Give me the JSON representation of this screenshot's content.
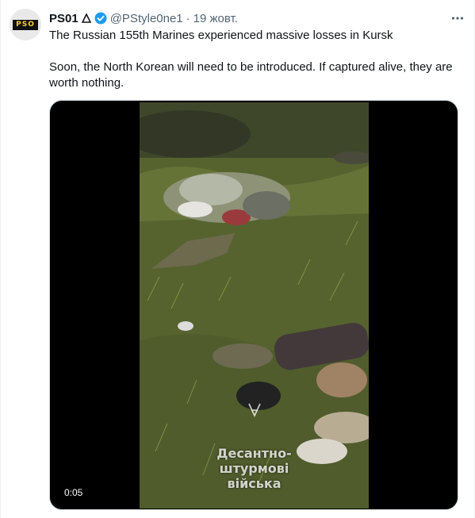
{
  "author": {
    "display_name": "PS01",
    "handle": "@PStyle0ne1",
    "separator": "·",
    "date": "19 жовт.",
    "avatar_text": "PSO"
  },
  "tweet": {
    "paragraph_1": "The Russian 155th Marines experienced massive losses in Kursk",
    "paragraph_2": "Soon, the North Korean will need to be introduced. If captured alive, they are worth nothing."
  },
  "media": {
    "caption_line_1": "Десантно-",
    "caption_line_2": "штурмові",
    "caption_line_3": "війська",
    "timestamp": "0:05"
  },
  "colors": {
    "verified": "#1d9bf0",
    "secondary_text": "#536471"
  },
  "icons": {
    "triangle": "triangle-icon",
    "verified": "verified-badge-icon",
    "more": "more-options-icon"
  }
}
